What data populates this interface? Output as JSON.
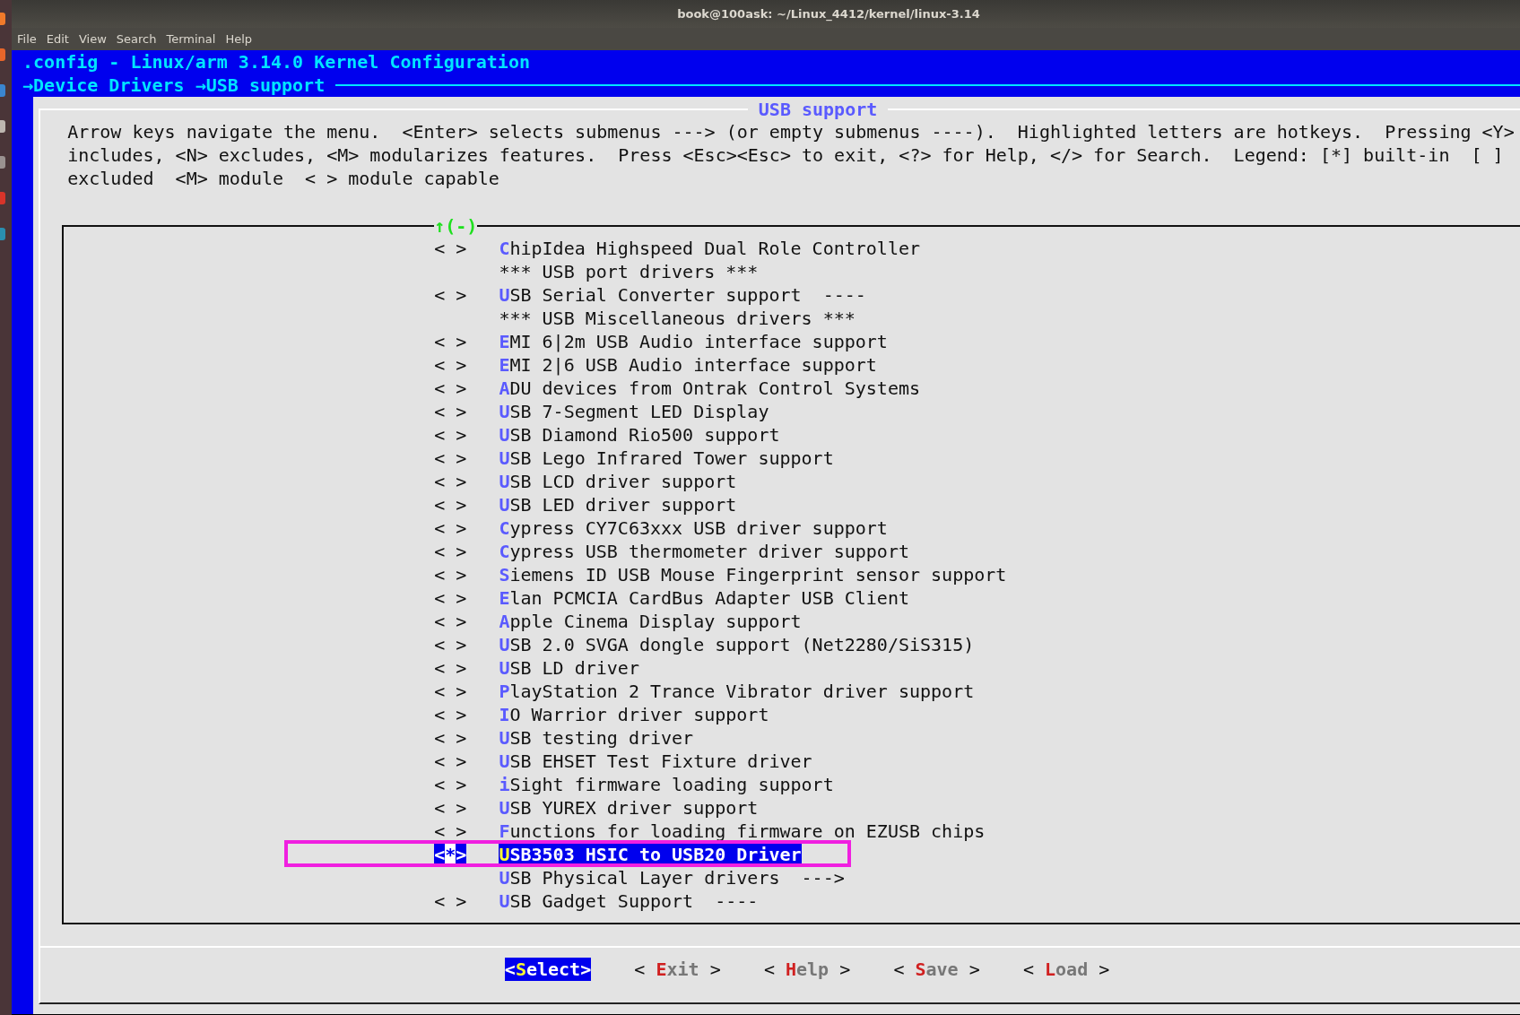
{
  "window": {
    "title": "book@100ask: ~/Linux_4412/kernel/linux-3.14"
  },
  "menu_bar": [
    "File",
    "Edit",
    "View",
    "Search",
    "Terminal",
    "Help"
  ],
  "header": {
    "title": ".config - Linux/arm 3.14.0 Kernel Configuration",
    "breadcrumb": [
      "→Device Drivers",
      "→USB support"
    ]
  },
  "dialog": {
    "title": "USB support",
    "help_lines": [
      "Arrow keys navigate the menu.  <Enter> selects submenus ---> (or empty submenus ----).  Highlighted letters are hotkeys.  Pressing <Y>",
      "includes, <N> excludes, <M> modularizes features.  Press <Esc><Esc> to exit, <?> for Help, </> for Search.  Legend: [*] built-in  [ ]",
      "excluded  <M> module  < > module capable"
    ],
    "scroll_indicator": "↑(-)",
    "items": [
      {
        "kind": "option",
        "marker": "< >",
        "label": "ChipIdea Highspeed Dual Role Controller",
        "selected": false
      },
      {
        "kind": "comment",
        "label": "*** USB port drivers ***"
      },
      {
        "kind": "option",
        "marker": "< >",
        "label": "USB Serial Converter support  ----",
        "selected": false
      },
      {
        "kind": "comment",
        "label": "*** USB Miscellaneous drivers ***"
      },
      {
        "kind": "option",
        "marker": "< >",
        "label": "EMI 6|2m USB Audio interface support",
        "selected": false
      },
      {
        "kind": "option",
        "marker": "< >",
        "label": "EMI 2|6 USB Audio interface support",
        "selected": false
      },
      {
        "kind": "option",
        "marker": "< >",
        "label": "ADU devices from Ontrak Control Systems",
        "selected": false
      },
      {
        "kind": "option",
        "marker": "< >",
        "label": "USB 7-Segment LED Display",
        "selected": false
      },
      {
        "kind": "option",
        "marker": "< >",
        "label": "USB Diamond Rio500 support",
        "selected": false
      },
      {
        "kind": "option",
        "marker": "< >",
        "label": "USB Lego Infrared Tower support",
        "selected": false
      },
      {
        "kind": "option",
        "marker": "< >",
        "label": "USB LCD driver support",
        "selected": false
      },
      {
        "kind": "option",
        "marker": "< >",
        "label": "USB LED driver support",
        "selected": false
      },
      {
        "kind": "option",
        "marker": "< >",
        "label": "Cypress CY7C63xxx USB driver support",
        "selected": false
      },
      {
        "kind": "option",
        "marker": "< >",
        "label": "Cypress USB thermometer driver support",
        "selected": false
      },
      {
        "kind": "option",
        "marker": "< >",
        "label": "Siemens ID USB Mouse Fingerprint sensor support",
        "selected": false
      },
      {
        "kind": "option",
        "marker": "< >",
        "label": "Elan PCMCIA CardBus Adapter USB Client",
        "selected": false
      },
      {
        "kind": "option",
        "marker": "< >",
        "label": "Apple Cinema Display support",
        "selected": false
      },
      {
        "kind": "option",
        "marker": "< >",
        "label": "USB 2.0 SVGA dongle support (Net2280/SiS315)",
        "selected": false
      },
      {
        "kind": "option",
        "marker": "< >",
        "label": "USB LD driver",
        "selected": false
      },
      {
        "kind": "option",
        "marker": "< >",
        "label": "PlayStation 2 Trance Vibrator driver support",
        "selected": false
      },
      {
        "kind": "option",
        "marker": "< >",
        "label": "IO Warrior driver support",
        "selected": false
      },
      {
        "kind": "option",
        "marker": "< >",
        "label": "USB testing driver",
        "selected": false
      },
      {
        "kind": "option",
        "marker": "< >",
        "label": "USB EHSET Test Fixture driver",
        "selected": false
      },
      {
        "kind": "option",
        "marker": "< >",
        "label": "iSight firmware loading support",
        "selected": false
      },
      {
        "kind": "option",
        "marker": "< >",
        "label": "USB YUREX driver support",
        "selected": false
      },
      {
        "kind": "option",
        "marker": "< >",
        "label": "Functions for loading firmware on EZUSB chips",
        "selected": false
      },
      {
        "kind": "option",
        "marker": "<*>",
        "label": "USB3503 HSIC to USB20 Driver",
        "selected": true
      },
      {
        "kind": "submenu",
        "label": "USB Physical Layer drivers  --->",
        "selected": false
      },
      {
        "kind": "option",
        "marker": "< >",
        "label": "USB Gadget Support  ----",
        "selected": false
      }
    ],
    "buttons": [
      {
        "left": "<",
        "label": "Select",
        "right": ">",
        "selected": true
      },
      {
        "left": "< ",
        "label": "Exit",
        "right": " >",
        "selected": false
      },
      {
        "left": "< ",
        "label": "Help",
        "right": " >",
        "selected": false
      },
      {
        "left": "< ",
        "label": "Save",
        "right": " >",
        "selected": false
      },
      {
        "left": "< ",
        "label": "Load",
        "right": " >",
        "selected": false
      }
    ]
  }
}
